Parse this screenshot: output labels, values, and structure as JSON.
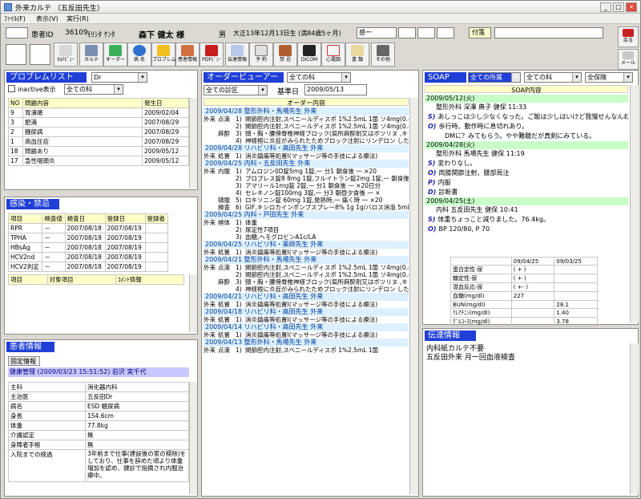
{
  "window": {
    "title": "外来カルテ （五反田先生）",
    "controls": [
      "_",
      "□",
      "×"
    ]
  },
  "menu": [
    "ﾌｧｲﾙ(F)",
    "表示(V)",
    "実行(R)"
  ],
  "patient": {
    "id_label": "患者ID",
    "id": "36109",
    "kana": "ﾓﾘｼﾀ ｹﾝﾀ",
    "name": "森下 健太 様",
    "sex": "男",
    "birth": "大正13年12月13日生 (満84歳5ヶ月)",
    "infection_label": "感一",
    "sticky_label": "付箋"
  },
  "toolbar": [
    "ｶﾙﾃﾋﾞｭｰ",
    "カルテ",
    "オーダー",
    "病 名",
    "プロブレム",
    "患者情報",
    "PDFﾋﾞｭｰ",
    "伝達情報",
    "予 約",
    "禁 忌",
    "DICOM",
    "心電図",
    "書 類",
    "その他"
  ],
  "right_buttons": {
    "back": "戻る",
    "mail": "メール"
  },
  "problem": {
    "title": "プロブレムリスト",
    "filter": "Dr",
    "inactive_label": "inactive表示",
    "scope": "全ての科",
    "cols": [
      "NO",
      "問題内容",
      "発生日"
    ],
    "rows": [
      [
        "9",
        "胃潰瘍",
        "2009/02/04"
      ],
      [
        "3",
        "肥満",
        "2007/08/29"
      ],
      [
        "2",
        "糖尿病",
        "2007/08/29"
      ],
      [
        "1",
        "高血圧症",
        "2007/08/29"
      ],
      [
        "18",
        "問題あり",
        "2009/05/12"
      ],
      [
        "17",
        "急性咽頭炎",
        "2009/05/12"
      ]
    ]
  },
  "infection": {
    "title": "感染・禁忌",
    "cols": [
      "項目",
      "検査値",
      "検査日",
      "登録日",
      "登録者"
    ],
    "rows": [
      [
        "RPR",
        "－",
        "2007/08/18",
        "2007/08/19",
        ""
      ],
      [
        "TPHA",
        "－",
        "2007/08/18",
        "2007/08/19",
        ""
      ],
      [
        "HBsAg",
        "－",
        "2007/08/18",
        "2007/08/19",
        ""
      ],
      [
        "HCV2nd",
        "－",
        "2007/08/18",
        "2007/08/19",
        ""
      ],
      [
        "HCV2判定",
        "－",
        "2007/08/18",
        "2007/08/19",
        ""
      ]
    ],
    "cols2": [
      "項目",
      "対象項目",
      "ｺﾒﾝﾄ情報"
    ]
  },
  "patinfo": {
    "title": "患者情報",
    "fixed_tab": "固定情報",
    "header": "健康管理 (2009/03/23 15:51:52) 岩沢 実千代",
    "rows": [
      [
        "主科",
        "消化器内科"
      ],
      [
        "主治医",
        "五反田Dr"
      ],
      [
        "病名",
        "ESD 糖尿病"
      ],
      [
        "身長",
        "154.6cm"
      ],
      [
        "体重",
        "77.8kg"
      ],
      [
        "介護認定",
        "無"
      ],
      [
        "身障者手帳",
        "無"
      ],
      [
        "入院までの経過",
        "3年前まで仕事(建設後の家の掃除)をしており、仕事を辞めた頃より体重増加を認め、健診で指摘され内服治療中。"
      ]
    ]
  },
  "order": {
    "title": "オーダービューアー",
    "dept": "全ての科",
    "scope": "全ての診区",
    "base_label": "基準日",
    "base_date": "2009/05/13",
    "col": "オーダー内容",
    "lines": [
      {
        "t": "d",
        "v": "2009/04/28 整形外科・馬場先生 外来"
      },
      {
        "t": "r",
        "a": "外来",
        "b": "点滴",
        "n": "1)",
        "v": "関節腔内注射,スベニールディスポ 1%2.5mL 1箇 ソ4mg(0.4%)1管"
      },
      {
        "t": "r",
        "a": "",
        "b": "",
        "n": "2)",
        "v": "関節腔内注射,スベニールディスポ 1%2.5mL 1箇 ソ4mg(0.4%)1管"
      },
      {
        "t": "r",
        "a": "",
        "b": "麻酔",
        "n": "3)",
        "v": "頸・胸・腰傍脊椎神経ブロック(局所麻酔剤又はボツリヌ ,キシロカインポリアンプ1% 5mL 1管リンデロン注4 .4%)1管"
      },
      {
        "t": "r",
        "a": "",
        "b": "",
        "n": "4)",
        "v": "神経根に炎症がみられたためブロック注射にリンデロン した。"
      },
      {
        "t": "d",
        "v": "2009/04/28 リハビリ科・高田先生 外来"
      },
      {
        "t": "r",
        "a": "外来",
        "b": "処置",
        "n": "1)",
        "v": "消炎鎮痛等処置I(マッサージ等の手技による療法)"
      },
      {
        "t": "d",
        "v": "2009/04/25 内科・五反田先生 外来"
      },
      {
        "t": "r",
        "a": "外来",
        "b": "内服",
        "n": "1)",
        "v": "アムロジン0D錠5mg 1錠,一 分1 朝食後 一 ×20"
      },
      {
        "t": "r",
        "a": "",
        "b": "",
        "n": "2)",
        "v": "プロプレス錠8 8mg 1錠,フルイトラン錠2mg 1錠,一 朝食後 一 ×20日分"
      },
      {
        "t": "r",
        "a": "",
        "b": "",
        "n": "3)",
        "v": "アマリール1mg錠 2錠,一 分1 朝食後 一 ×20日分"
      },
      {
        "t": "r",
        "a": "",
        "b": "",
        "n": "4)",
        "v": "セレキノン錠100mg 3錠,一 分3 朝昼夕食後 一 ×"
      },
      {
        "t": "r",
        "a": "",
        "b": "頓服",
        "n": "5)",
        "v": "ロキソニン錠 60mg 1錠,発熱時,一 痛く時 一 ×20"
      },
      {
        "t": "r",
        "a": "",
        "b": "検査",
        "n": "6)",
        "v": "GIF,キシロカインポンプスプレー8% 1g 1g/バロス消泡 5mL 1箇,ガスコン水40mg/mL 20mL"
      },
      {
        "t": "d",
        "v": "2009/04/25 内科・戸田先生 外来"
      },
      {
        "t": "r",
        "a": "外来",
        "b": "検体",
        "n": "1)",
        "v": "体重"
      },
      {
        "t": "r",
        "a": "",
        "b": "",
        "n": "2)",
        "v": "尿定性7項目"
      },
      {
        "t": "r",
        "a": "",
        "b": "",
        "n": "3)",
        "v": "血糖,ヘモグロビンA1c/LA"
      },
      {
        "t": "d",
        "v": "2009/04/25 リハビリ科・薬師先生 外来"
      },
      {
        "t": "r",
        "a": "外来",
        "b": "処置",
        "n": "1)",
        "v": "消炎鎮痛等処置I(マッサージ等の手技による療法)"
      },
      {
        "t": "d",
        "v": "2009/04/21 整形外科・馬場先生 外来"
      },
      {
        "t": "r",
        "a": "外来",
        "b": "点滴",
        "n": "1)",
        "v": "関節腔内注射,スベニールディスポ 1%2.5mL 1箇 ソ4mg(0.4%)1管"
      },
      {
        "t": "r",
        "a": "",
        "b": "",
        "n": "2)",
        "v": "関節腔内注射,スベニールディスポ 1%2.5mL 1箇 ソ4mg(0.4%)1管"
      },
      {
        "t": "r",
        "a": "",
        "b": "麻酔",
        "n": "3)",
        "v": "頸・胸・腰傍脊椎神経ブロック(局所麻酔剤又はボツリヌ ,キシロカインポリアンプ1% 5mL 1管リンデロン注4 .4%)1管"
      },
      {
        "t": "r",
        "a": "",
        "b": "",
        "n": "4)",
        "v": "神経根に炎症がみられたためブロック注射にリンデロン した。"
      },
      {
        "t": "d",
        "v": "2009/04/21 リハビリ科・高田先生 外来"
      },
      {
        "t": "r",
        "a": "外来",
        "b": "処置",
        "n": "1)",
        "v": "消炎鎮痛等処置I(マッサージ等の手技による療法)"
      },
      {
        "t": "d",
        "v": "2009/04/18 リハビリ科・高田先生 外来"
      },
      {
        "t": "r",
        "a": "外来",
        "b": "処置",
        "n": "1)",
        "v": "消炎鎮痛等処置I(マッサージ等の手技による療法)"
      },
      {
        "t": "d",
        "v": "2009/04/14 リハビリ科・高田先生 外来"
      },
      {
        "t": "r",
        "a": "外来",
        "b": "処置",
        "n": "1)",
        "v": "消炎鎮痛等処置I(マッサージ等の手技による療法)"
      },
      {
        "t": "d",
        "v": "2009/04/13 整形外科・馬場先生 外来"
      },
      {
        "t": "r",
        "a": "外来",
        "b": "点滴",
        "n": "1)",
        "v": "関節腔内注射,スベニールディスポ 1%2.5mL 1箇"
      }
    ]
  },
  "soap": {
    "title": "SOAP",
    "tab": "全ての所属",
    "dept": "全ての科",
    "ins": "全保険",
    "col": "SOAP内容",
    "entries": [
      {
        "t": "date",
        "v": "2009/05/12(火)"
      },
      {
        "t": "head",
        "v": "整形外科 深澤 典子 健保 11:33"
      },
      {
        "t": "line",
        "k": "S)",
        "v": "あしっこは少し少なくなった。ご飯は少しはいけど我慢せんなんね。"
      },
      {
        "t": "line",
        "k": "O)",
        "v": "歩行時、動作時に息切れあり。"
      },
      {
        "t": "line",
        "k": "",
        "v": "DMに？みてもらう。やや難聴だが真剣にみている。"
      },
      {
        "t": "date",
        "v": "2009/04/28(火)"
      },
      {
        "t": "head",
        "v": "整形外科 馬場先生 健保 11:19"
      },
      {
        "t": "line",
        "k": "S)",
        "v": "変わりなし。"
      },
      {
        "t": "line",
        "k": "O)",
        "v": "両膝関節注射、腰部局注"
      },
      {
        "t": "line",
        "k": "P)",
        "v": "内服"
      },
      {
        "t": "line",
        "k": "D)",
        "v": "診断書"
      },
      {
        "t": "date",
        "v": "2009/04/25(土)"
      },
      {
        "t": "head",
        "v": "内科 五反田先生 健保 10:41"
      },
      {
        "t": "line",
        "k": "S)",
        "v": "体重ちょっこと減りました。76.4kg。"
      },
      {
        "t": "line",
        "k": "O)",
        "v": "BP 120/80, P 70"
      }
    ],
    "lab_cols": [
      "",
      "09/04/25",
      "09/03/25"
    ],
    "lab": [
      [
        "蛋白定性-尿",
        "( + )",
        ""
      ],
      [
        "糖定性-尿",
        "( + )",
        ""
      ],
      [
        "潜血反応-尿",
        "( +- )",
        ""
      ],
      [
        "血糖(mg/dl)",
        "227",
        ""
      ],
      [
        "BUN(mg/dl)",
        "",
        "28.1"
      ],
      [
        "ｸﾚｱﾁﾆﾝ(mg/dl)",
        "",
        "1.40"
      ],
      [
        "ｸﾞﾙｺｰｽ(mg/dl)",
        "",
        "3.78"
      ]
    ]
  },
  "dengon": {
    "title": "伝達情報",
    "lines": [
      "内科紙カルテ不要",
      "五反田外来 月一回血液検査"
    ]
  }
}
